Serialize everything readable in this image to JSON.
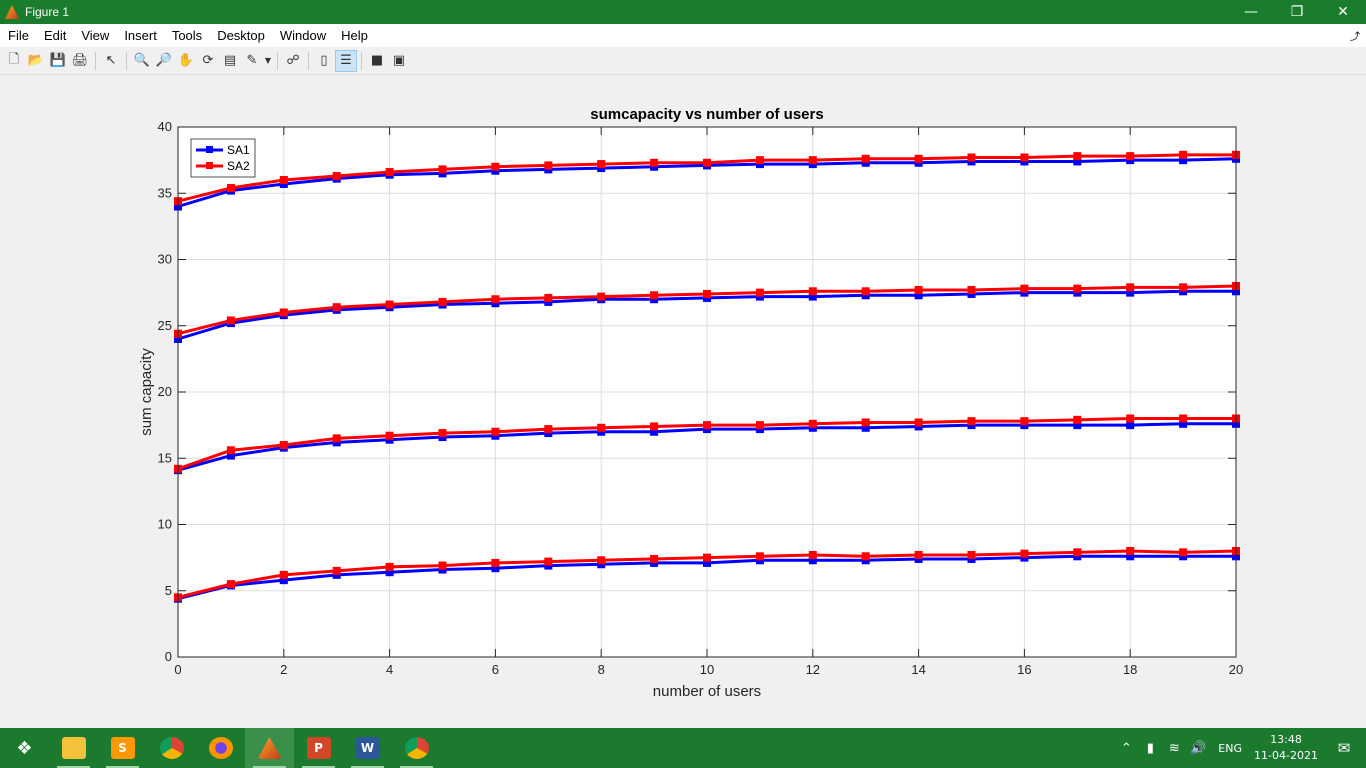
{
  "window": {
    "title": "Figure 1"
  },
  "menu": [
    "File",
    "Edit",
    "View",
    "Insert",
    "Tools",
    "Desktop",
    "Window",
    "Help"
  ],
  "taskbar": {
    "lang": "ENG",
    "time": "13:48",
    "date": "11-04-2021"
  },
  "chart_data": {
    "type": "line",
    "title": "sumcapacity vs number of users",
    "xlabel": "number of users",
    "ylabel": "sum capacity",
    "xlim": [
      0,
      20
    ],
    "ylim": [
      0,
      40
    ],
    "xticks": [
      0,
      2,
      4,
      6,
      8,
      10,
      12,
      14,
      16,
      18,
      20
    ],
    "yticks": [
      0,
      5,
      10,
      15,
      20,
      25,
      30,
      35,
      40
    ],
    "grid": true,
    "legend": {
      "position": "top-left",
      "entries": [
        "SA1",
        "SA2"
      ]
    },
    "x": [
      0,
      1,
      2,
      3,
      4,
      5,
      6,
      7,
      8,
      9,
      10,
      11,
      12,
      13,
      14,
      15,
      16,
      17,
      18,
      19,
      20
    ],
    "series": [
      {
        "name": "SA1",
        "group": 1,
        "color": "#0000ff",
        "values": [
          4.4,
          5.4,
          5.8,
          6.2,
          6.4,
          6.6,
          6.7,
          6.9,
          7.0,
          7.1,
          7.1,
          7.3,
          7.3,
          7.3,
          7.4,
          7.4,
          7.5,
          7.6,
          7.6,
          7.6,
          7.6
        ]
      },
      {
        "name": "SA2",
        "group": 1,
        "color": "#ff0000",
        "values": [
          4.5,
          5.5,
          6.2,
          6.5,
          6.8,
          6.9,
          7.1,
          7.2,
          7.3,
          7.4,
          7.5,
          7.6,
          7.7,
          7.6,
          7.7,
          7.7,
          7.8,
          7.9,
          8.0,
          7.9,
          8.0
        ]
      },
      {
        "name": "SA1",
        "group": 2,
        "color": "#0000ff",
        "values": [
          14.1,
          15.2,
          15.8,
          16.2,
          16.4,
          16.6,
          16.7,
          16.9,
          17.0,
          17.0,
          17.2,
          17.2,
          17.3,
          17.3,
          17.4,
          17.5,
          17.5,
          17.5,
          17.5,
          17.6,
          17.6
        ]
      },
      {
        "name": "SA2",
        "group": 2,
        "color": "#ff0000",
        "values": [
          14.2,
          15.6,
          16.0,
          16.5,
          16.7,
          16.9,
          17.0,
          17.2,
          17.3,
          17.4,
          17.5,
          17.5,
          17.6,
          17.7,
          17.7,
          17.8,
          17.8,
          17.9,
          18.0,
          18.0,
          18.0
        ]
      },
      {
        "name": "SA1",
        "group": 3,
        "color": "#0000ff",
        "values": [
          24.0,
          25.2,
          25.8,
          26.2,
          26.4,
          26.6,
          26.7,
          26.8,
          27.0,
          27.0,
          27.1,
          27.2,
          27.2,
          27.3,
          27.3,
          27.4,
          27.5,
          27.5,
          27.5,
          27.6,
          27.6
        ]
      },
      {
        "name": "SA2",
        "group": 3,
        "color": "#ff0000",
        "values": [
          24.4,
          25.4,
          26.0,
          26.4,
          26.6,
          26.8,
          27.0,
          27.1,
          27.2,
          27.3,
          27.4,
          27.5,
          27.6,
          27.6,
          27.7,
          27.7,
          27.8,
          27.8,
          27.9,
          27.9,
          28.0
        ]
      },
      {
        "name": "SA1",
        "group": 4,
        "color": "#0000ff",
        "values": [
          34.0,
          35.2,
          35.7,
          36.1,
          36.4,
          36.5,
          36.7,
          36.8,
          36.9,
          37.0,
          37.1,
          37.2,
          37.2,
          37.3,
          37.3,
          37.4,
          37.4,
          37.4,
          37.5,
          37.5,
          37.6
        ]
      },
      {
        "name": "SA2",
        "group": 4,
        "color": "#ff0000",
        "values": [
          34.4,
          35.4,
          36.0,
          36.3,
          36.6,
          36.8,
          37.0,
          37.1,
          37.2,
          37.3,
          37.3,
          37.5,
          37.5,
          37.6,
          37.6,
          37.7,
          37.7,
          37.8,
          37.8,
          37.9,
          37.9
        ]
      }
    ]
  }
}
